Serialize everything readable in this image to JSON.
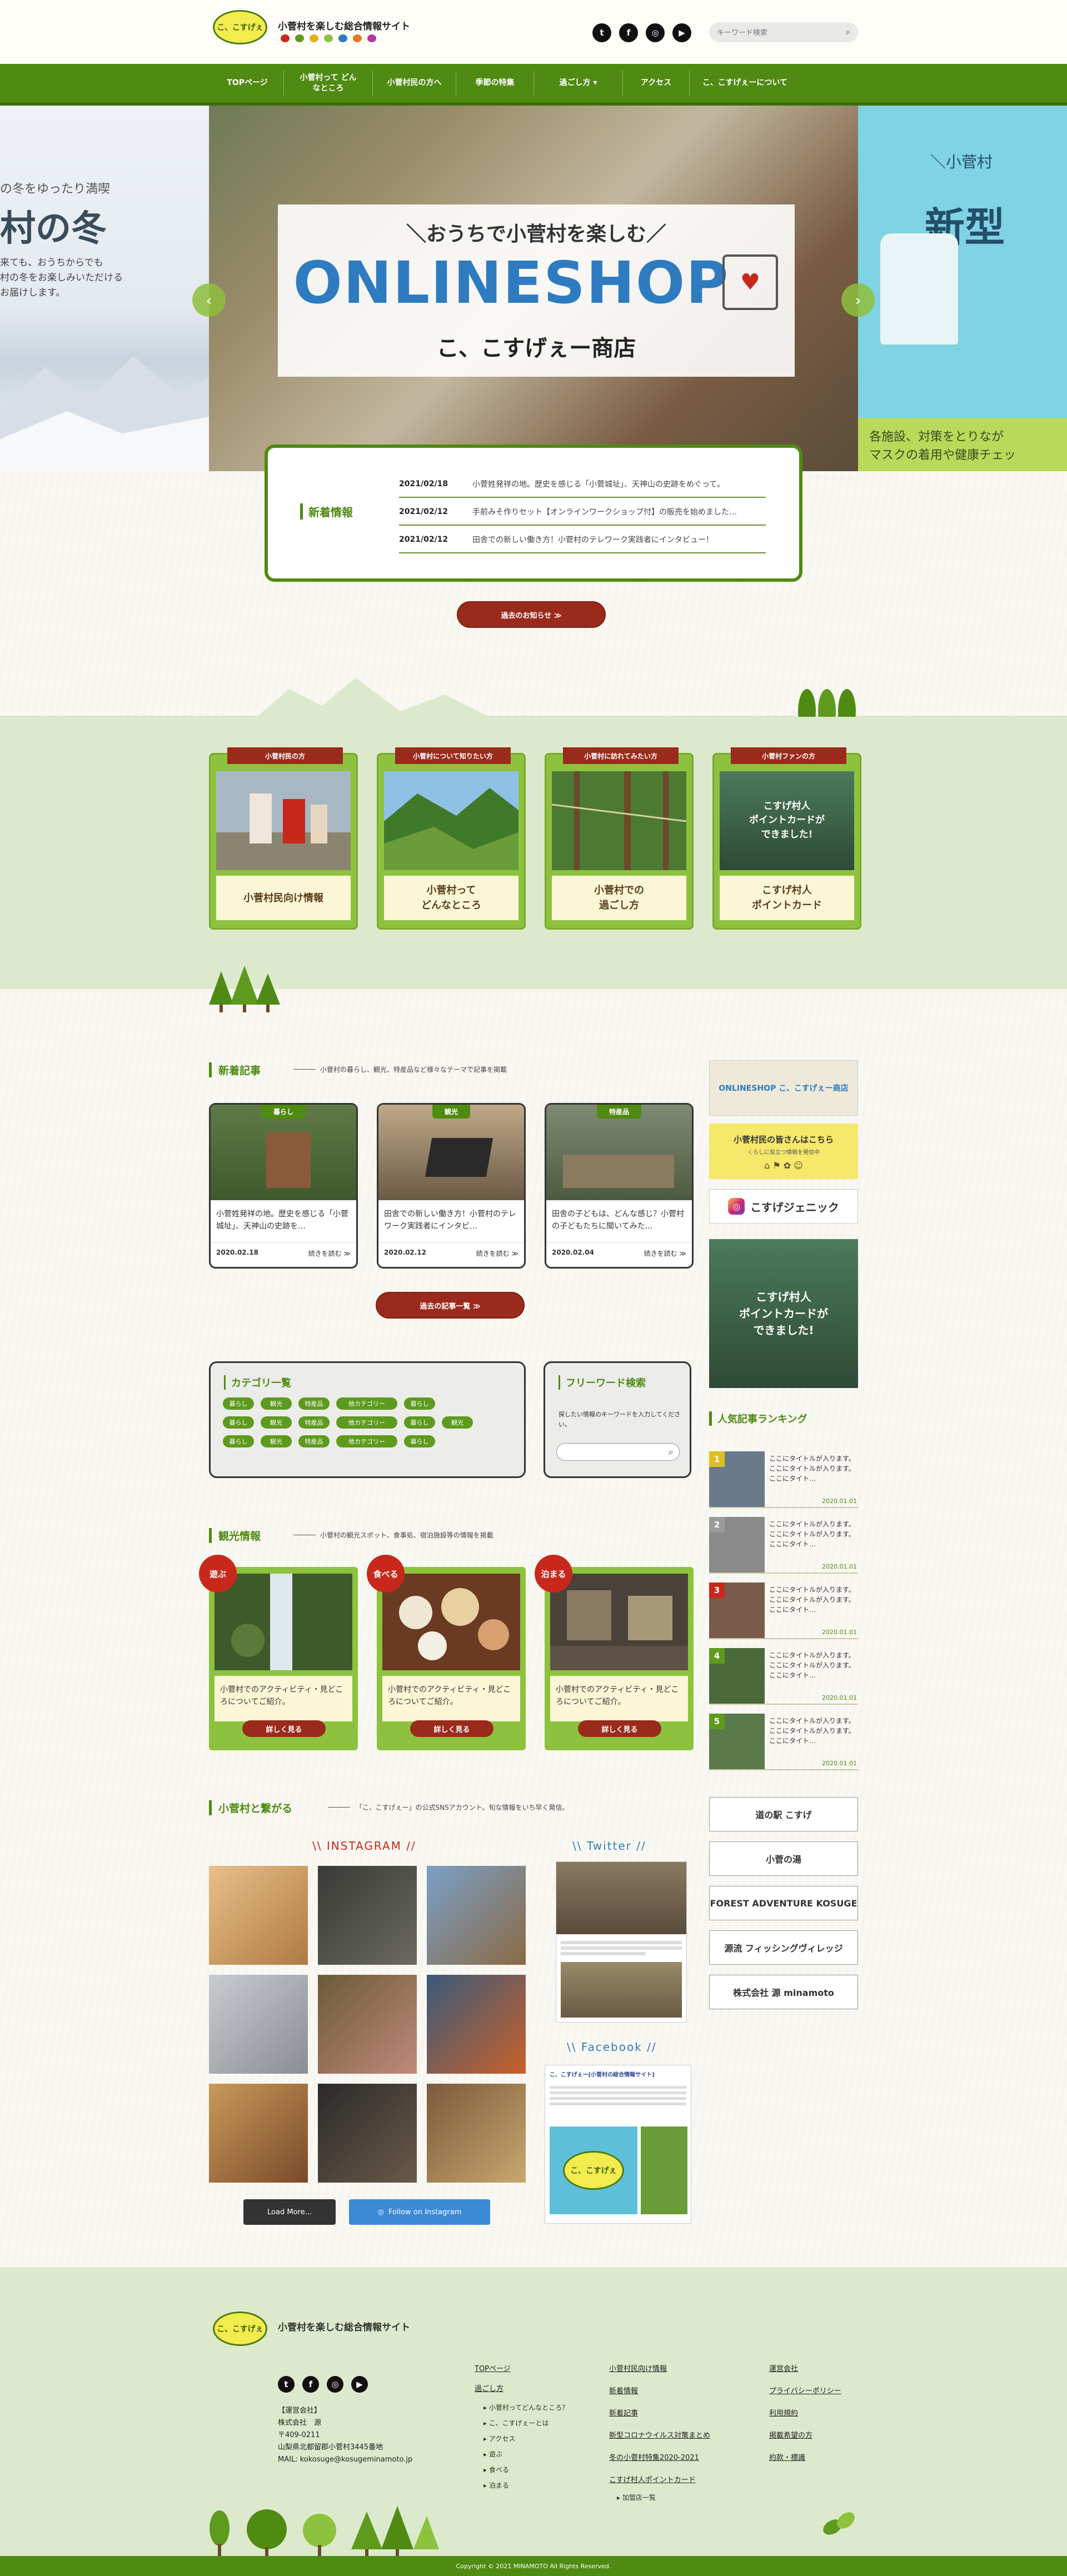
{
  "header": {
    "logo_text": "こ、こすげぇ",
    "site_title": "小菅村を楽しむ総合情報サイト",
    "search_placeholder": "キーワード検索"
  },
  "nav": {
    "items": [
      {
        "label": "TOPページ"
      },
      {
        "label": "小菅村って どんなところ"
      },
      {
        "label": "小菅村民の方へ"
      },
      {
        "label": "季節の特集"
      },
      {
        "label": "過ごし方 ▾"
      },
      {
        "label": "アクセス"
      },
      {
        "label": "こ、こすげぇーについて"
      }
    ]
  },
  "hero": {
    "left_text_1": "の冬をゆったり満喫",
    "left_text_2": "村の冬",
    "left_text_3": "来ても、おうちからでも",
    "left_text_4": "村の冬をお楽しみいただける",
    "left_text_5": "お届けします。",
    "sub": "＼おうちで小菅村を楽しむ／",
    "main": "ONLINESHOP",
    "shop_name": "こ、こすげぇー商店",
    "right_top": "＼小菅村",
    "right_big": "新型",
    "right_bottom_1": "各施設、対策をとりなが",
    "right_bottom_2": "マスクの着用や健康チェッ",
    "prev": "‹",
    "next": "›"
  },
  "news": {
    "heading": "新着情報",
    "items": [
      {
        "date": "2021/02/18",
        "text": "小菅姓発祥の地。歴史を感じる「小菅城址」、天神山の史跡をめぐって。"
      },
      {
        "date": "2021/02/12",
        "text": "手前みそ作りセット【オンラインワークショップ付】の販売を始めました…"
      },
      {
        "date": "2021/02/12",
        "text": "田舎での新しい働き方！小菅村のテレワーク実践者にインタビュー！"
      }
    ],
    "archive_btn": "過去のお知らせ ≫"
  },
  "categories": [
    {
      "ribbon": "小菅村民の方",
      "label": "小菅村民向け情報"
    },
    {
      "ribbon": "小菅村について知りたい方",
      "label": "小菅村って\nどんなところ"
    },
    {
      "ribbon": "小菅村に訪れてみたい方",
      "label": "小菅村での\n過ごし方"
    },
    {
      "ribbon": "小菅村ファンの方",
      "label": "こすげ村人\nポイントカード"
    }
  ],
  "card_banner": {
    "line1": "こすげ村人",
    "line2": "ポイントカードが",
    "line3": "できました!"
  },
  "articles_section": {
    "heading": "新着記事",
    "sub": "小菅村の暮らし、観光、特産品など様々なテーマで記事を掲載",
    "more_btn": "過去の記事一覧 ≫",
    "items": [
      {
        "tag": "暮らし",
        "text": "小菅姓発祥の地。歴史を感じる「小菅城址」、天神山の史跡を…",
        "date": "2020.02.18",
        "more": "続きを読む ≫"
      },
      {
        "tag": "観光",
        "text": "田舎での新しい働き方！小菅村のテレワーク実践者にインタビ…",
        "date": "2020.02.12",
        "more": "続きを読む ≫"
      },
      {
        "tag": "特産品",
        "text": "田舎の子どもは、どんな感じ？小菅村の子どもたちに聞いてみた…",
        "date": "2020.02.04",
        "more": "続きを読む ≫"
      }
    ]
  },
  "category_list": {
    "heading": "カテゴリ一覧",
    "rows": [
      [
        "暮らし",
        "観光",
        "特産品",
        "他カテゴリー",
        "暮らし"
      ],
      [
        "暮らし",
        "観光",
        "特産品",
        "他カテゴリー",
        "暮らし",
        "観光"
      ],
      [
        "暮らし",
        "観光",
        "特産品",
        "他カテゴリー",
        "暮らし"
      ]
    ]
  },
  "freeword": {
    "heading": "フリーワード検索",
    "desc": "探したい情報のキーワードを入力してください。",
    "placeholder": ""
  },
  "sightseeing": {
    "heading": "観光情報",
    "sub": "小菅村の観光スポット、食事処、宿泊施設等の情報を掲載",
    "items": [
      {
        "badge": "遊ぶ",
        "text": "小菅村でのアクティビティ・見どころについてご紹介。",
        "more": "詳しく見る"
      },
      {
        "badge": "食べる",
        "text": "小菅村でのアクティビティ・見どころについてご紹介。",
        "more": "詳しく見る"
      },
      {
        "badge": "泊まる",
        "text": "小菅村でのアクティビティ・見どころについてご紹介。",
        "more": "詳しく見る"
      }
    ]
  },
  "sns_section": {
    "heading": "小菅村と繋がる",
    "sub": "「こ、こすげぇー」の公式SNSアカウント。旬な情報をいち早く発信。",
    "instagram": "\\\\ INSTAGRAM //",
    "twitter": "\\\\ Twitter //",
    "facebook": "\\\\ Facebook //",
    "load_more": "Load More...",
    "follow": "Follow on Instagram",
    "fb_page": "こ、こすげぇー[小菅村の総合情報サイト]"
  },
  "sidebar": {
    "banner_shop": "ONLINESHOP こ、こすげぇー商店",
    "banner_villager": "小菅村民の皆さんはこちら",
    "banner_villager_sub": "くらしに役立つ情報を発信中",
    "banner_insta": "こすげジェニック",
    "ranking_heading": "人気記事ランキング",
    "ranking": [
      {
        "num": "1",
        "text": "ここにタイトルが入ります。ここにタイトルが入ります。ここにタイト…",
        "date": "2020.01.01"
      },
      {
        "num": "2",
        "text": "ここにタイトルが入ります。ここにタイトルが入ります。ここにタイト…",
        "date": "2020.01.01"
      },
      {
        "num": "3",
        "text": "ここにタイトルが入ります。ここにタイトルが入ります。ここにタイト…",
        "date": "2020.01.01"
      },
      {
        "num": "4",
        "text": "ここにタイトルが入ります。ここにタイトルが入ります。ここにタイト…",
        "date": "2020.01.01"
      },
      {
        "num": "5",
        "text": "ここにタイトルが入ります。ここにタイトルが入ります。ここにタイト…",
        "date": "2020.01.01"
      }
    ],
    "external": [
      "道の駅 こすげ",
      "小菅の湯",
      "FOREST ADVENTURE KOSUGE",
      "源流 フィッシングヴィレッジ",
      "株式会社 源 minamoto"
    ]
  },
  "footer": {
    "logo_text": "こ、こすげぇ",
    "site_title": "小菅村を楽しむ総合情報サイト",
    "operator_label": "【運営会社】",
    "company": "株式会社　源",
    "zip": "〒409-0211",
    "address": "山梨県北都留郡小菅村3445番地",
    "mail": "MAIL: kokosuge@kosugeminamoto.jp",
    "col1": [
      "TOPページ",
      "過ごし方"
    ],
    "col1_sub": [
      "小菅村ってどんなところ？",
      "こ、こすげぇーとは",
      "アクセス",
      "遊ぶ",
      "食べる",
      "泊まる"
    ],
    "col2": [
      "小菅村民向け情報",
      "新着情報",
      "新着記事",
      "新型コロナウイルス対策まとめ",
      "冬の小菅村特集2020-2021",
      "こすげ村人ポイントカード"
    ],
    "col2_sub": [
      "加盟店一覧"
    ],
    "col3": [
      "運営会社",
      "プライバシーポリシー",
      "利用規約",
      "掲載希望の方",
      "約款・標識"
    ],
    "copyright": "Copyright © 2021 MINAMOTO All Rights Reserved."
  },
  "colors": {
    "brand_green": "#4f8a12",
    "accent_red": "#9a2b1c",
    "light_green": "#8dc23e",
    "band_green": "#dde9cc"
  }
}
